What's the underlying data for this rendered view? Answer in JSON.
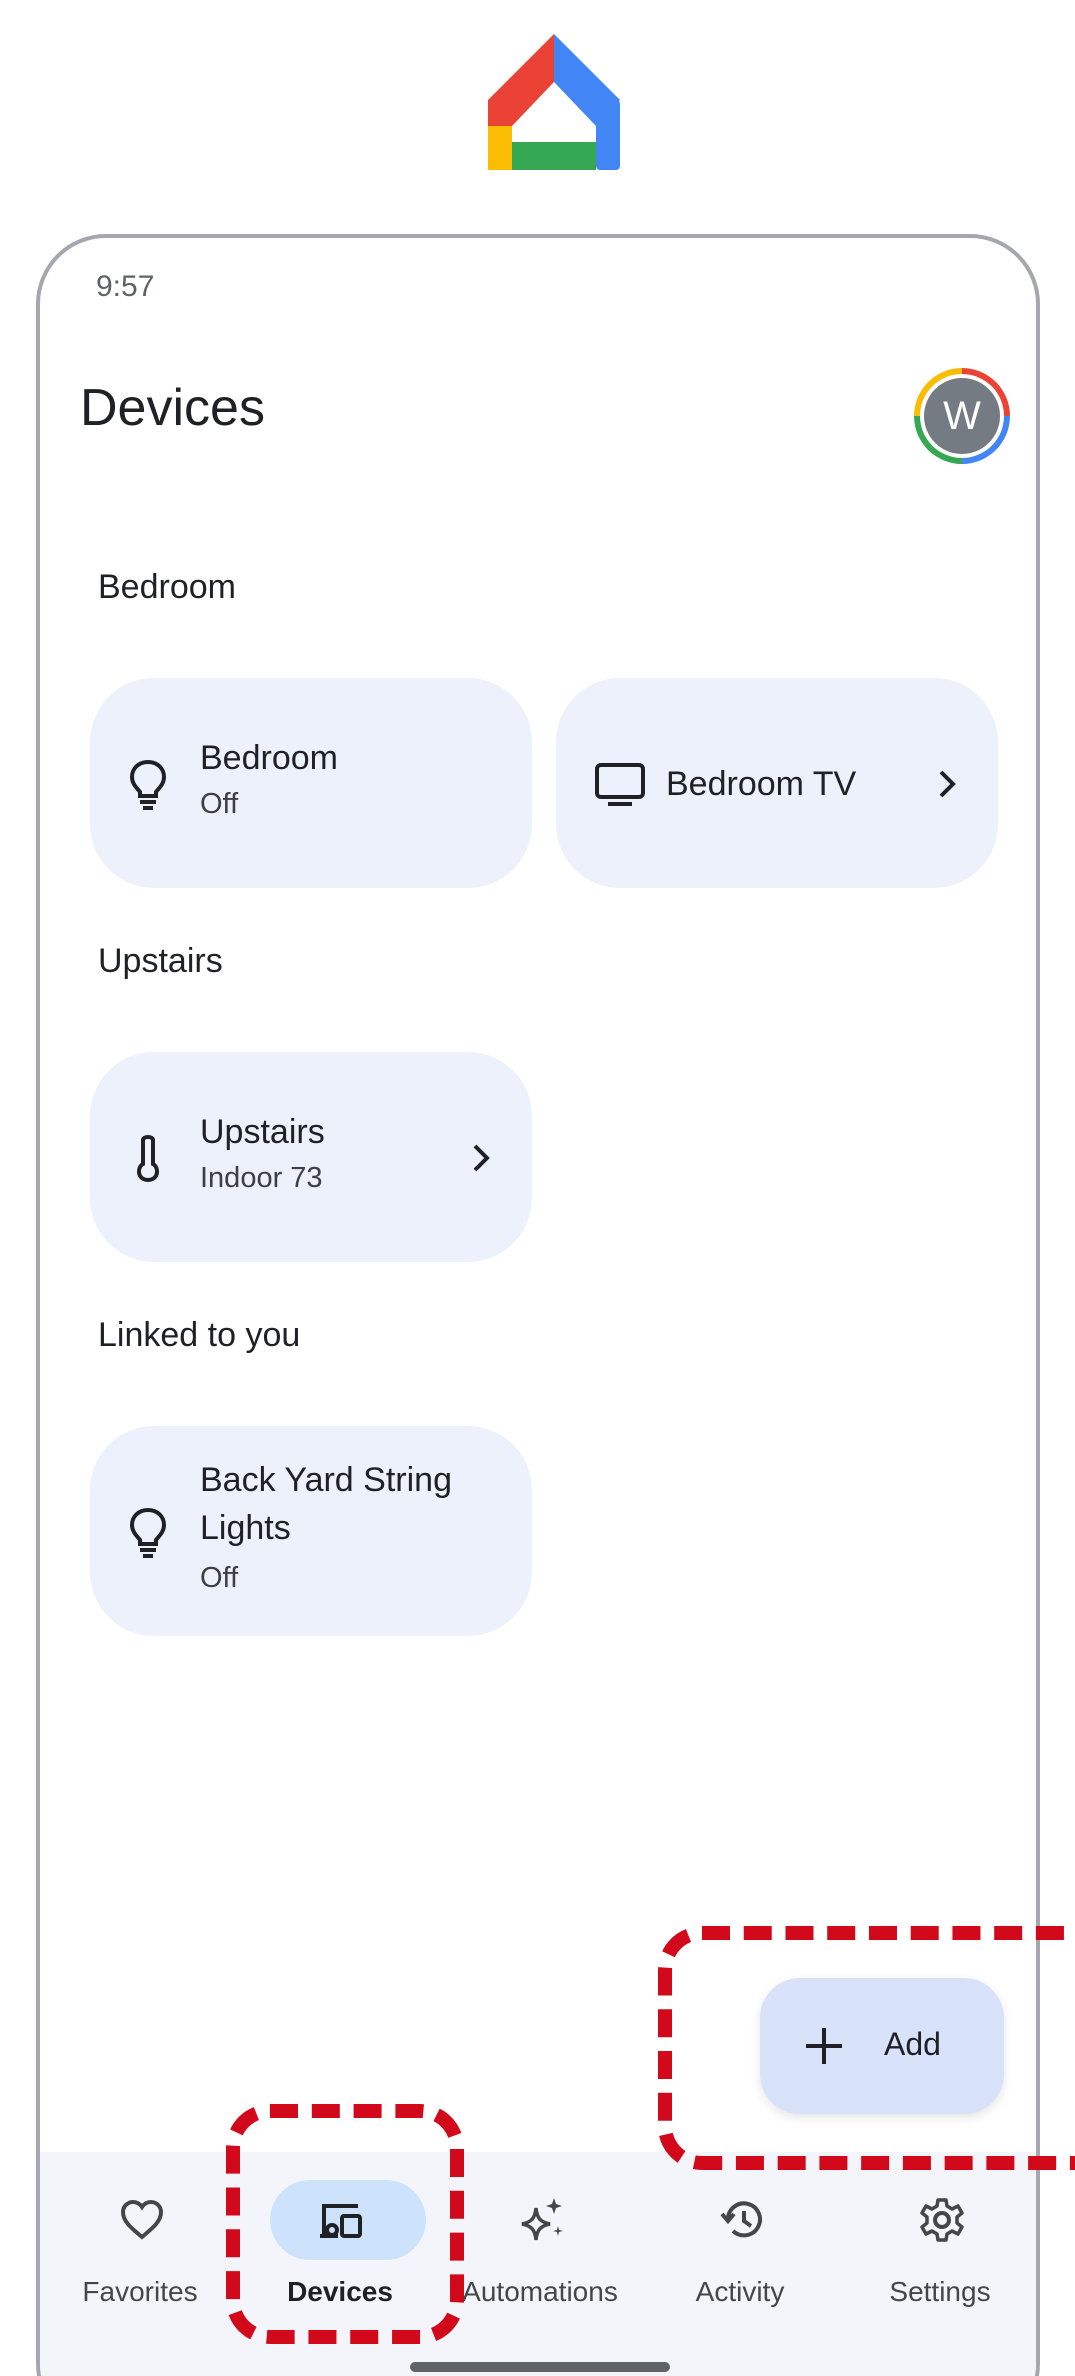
{
  "app": {
    "logo_icon": "google-home-logo-icon"
  },
  "status_bar": {
    "time": "9:57"
  },
  "header": {
    "title": "Devices",
    "avatar_initial": "W"
  },
  "sections": [
    {
      "label": "Bedroom",
      "tiles": [
        {
          "icon": "lightbulb-icon",
          "title": "Bedroom",
          "subtitle": "Off"
        },
        {
          "icon": "tv-icon",
          "title": "Bedroom TV"
        }
      ]
    },
    {
      "label": "Upstairs",
      "tiles": [
        {
          "icon": "thermometer-icon",
          "title": "Upstairs",
          "subtitle": "Indoor 73"
        }
      ]
    },
    {
      "label": "Linked to you",
      "tiles": [
        {
          "icon": "lightbulb-icon",
          "title_line1": "Back Yard String",
          "title_line2": "Lights",
          "subtitle": "Off"
        }
      ]
    }
  ],
  "fab": {
    "label": "Add"
  },
  "nav": {
    "items": [
      {
        "label": "Favorites",
        "icon": "heart-icon"
      },
      {
        "label": "Devices",
        "icon": "devices-icon",
        "active": true
      },
      {
        "label": "Automations",
        "icon": "sparkle-icon"
      },
      {
        "label": "Activity",
        "icon": "history-icon"
      },
      {
        "label": "Settings",
        "icon": "gear-icon"
      }
    ]
  },
  "colors": {
    "tile_bg": "#edf1fc",
    "fab_bg": "#d8e2f9",
    "nav_active_pill": "#cde3fb",
    "highlight": "#d2091a"
  }
}
